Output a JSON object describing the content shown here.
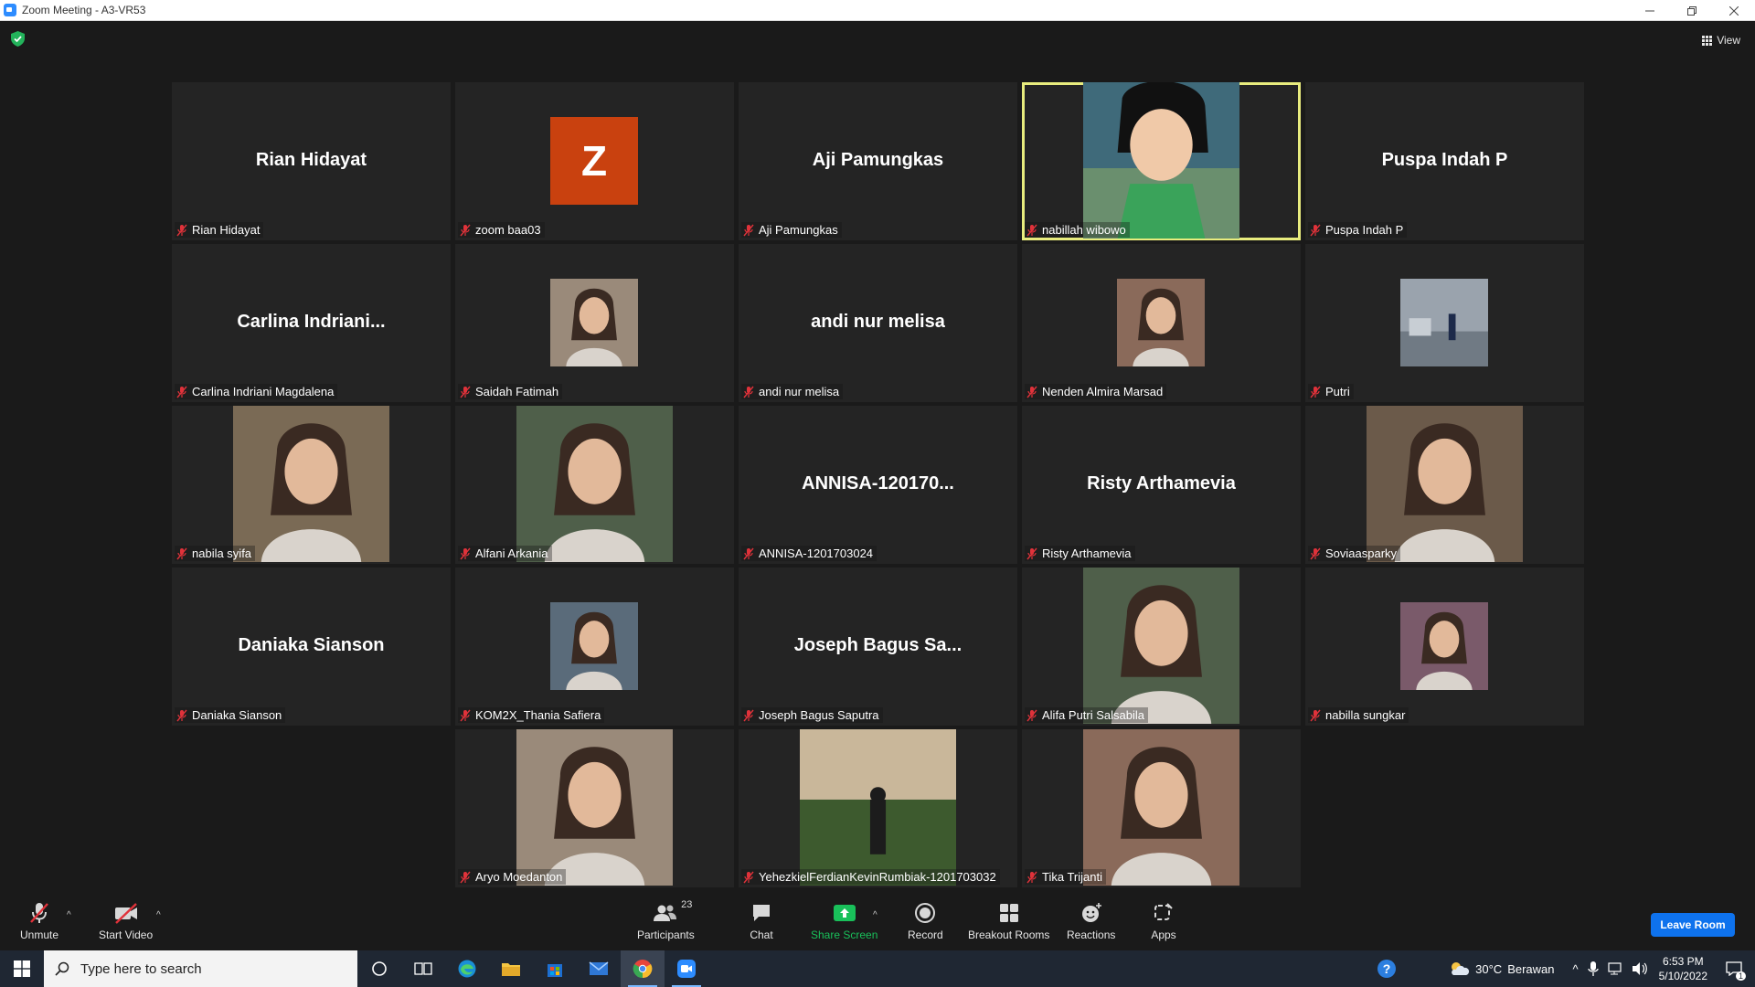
{
  "window": {
    "title": "Zoom Meeting - A3-VR53",
    "controls": [
      "minimize",
      "restore",
      "close"
    ]
  },
  "meeting": {
    "view_label": "View",
    "speaking": "nabillah wibowo",
    "tiles": [
      {
        "name": "Rian Hidayat",
        "big": "Rian Hidayat",
        "kind": "name"
      },
      {
        "name": "zoom baa03",
        "big": "Z",
        "kind": "letter"
      },
      {
        "name": "Aji Pamungkas",
        "big": "Aji Pamungkas",
        "kind": "name"
      },
      {
        "name": "nabillah wibowo",
        "kind": "video",
        "icon": "cartoon-fairy-photo"
      },
      {
        "name": "Puspa Indah P",
        "big": "Puspa Indah P",
        "kind": "name"
      },
      {
        "name": "Carlina Indriani Magdalena",
        "big": "Carlina  Indriani...",
        "kind": "name"
      },
      {
        "name": "Saidah Fatimah",
        "kind": "avatar",
        "icon": "person-photo"
      },
      {
        "name": "andi nur melisa",
        "big": "andi nur melisa",
        "kind": "name"
      },
      {
        "name": "Nenden Almira Marsad",
        "kind": "avatar",
        "icon": "person-photo"
      },
      {
        "name": "Putri",
        "kind": "avatar",
        "icon": "rooftop-photo"
      },
      {
        "name": "nabila syifa",
        "kind": "video",
        "icon": "person-photo"
      },
      {
        "name": "Alfani Arkania",
        "kind": "video",
        "icon": "person-photo"
      },
      {
        "name": "ANNISA-1201703024",
        "big": "ANNISA-120170...",
        "kind": "name"
      },
      {
        "name": "Risty Arthamevia",
        "big": "Risty Arthamevia",
        "kind": "name"
      },
      {
        "name": "Soviaasparky",
        "kind": "video",
        "icon": "person-photo"
      },
      {
        "name": "Daniaka Sianson",
        "big": "Daniaka Sianson",
        "kind": "name"
      },
      {
        "name": "KOM2X_Thania Safiera",
        "kind": "avatar",
        "icon": "person-photo"
      },
      {
        "name": "Joseph Bagus Saputra",
        "big": "Joseph Bagus Sa...",
        "kind": "name"
      },
      {
        "name": "Alifa Putri Salsabila",
        "kind": "video",
        "icon": "person-photo"
      },
      {
        "name": "nabilla sungkar",
        "kind": "avatar",
        "icon": "person-photo"
      },
      {
        "name": "Aryo Moedanton",
        "kind": "video",
        "icon": "person-photo"
      },
      {
        "name": "YehezkielFerdianKevinRumbiak-1201703032",
        "kind": "video",
        "icon": "landscape-photo"
      },
      {
        "name": "Tika Trijanti",
        "kind": "video",
        "icon": "person-photo"
      }
    ]
  },
  "toolbar": {
    "unmute": "Unmute",
    "start_video": "Start Video",
    "participants": "Participants",
    "participants_count": "23",
    "chat": "Chat",
    "share_screen": "Share Screen",
    "record": "Record",
    "breakout_rooms": "Breakout Rooms",
    "reactions": "Reactions",
    "apps": "Apps",
    "leave": "Leave Room"
  },
  "taskbar": {
    "search_placeholder": "Type here to search",
    "weather_temp": "30°C",
    "weather_desc": "Berawan",
    "time": "6:53 PM",
    "date": "5/10/2022",
    "notification_count": "1"
  },
  "colors": {
    "background": "#1a1a1a",
    "tile": "#242424",
    "speaking_border": "#e8ec7e",
    "mute_red": "#e0323a",
    "share_green": "#19c05a",
    "leave_blue": "#0e72ed"
  }
}
